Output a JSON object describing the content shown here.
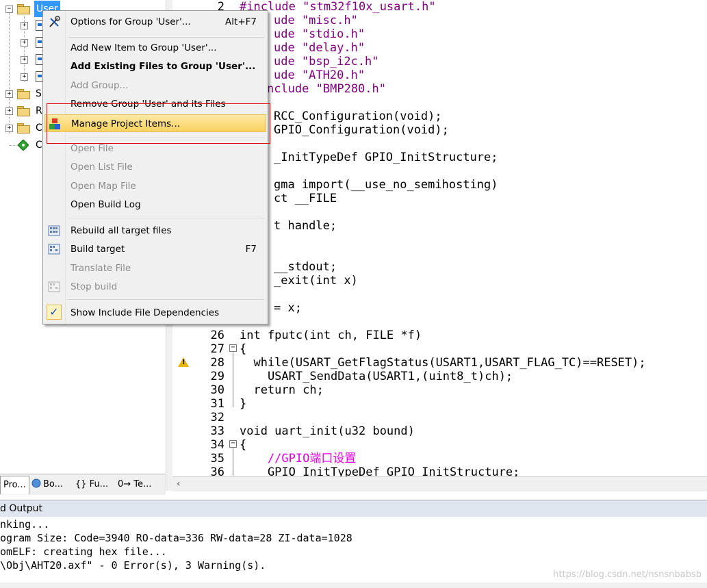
{
  "tree": {
    "root_label": "User",
    "rows": [
      {
        "label": "S"
      },
      {
        "label": "R"
      },
      {
        "label": "C"
      },
      {
        "label": "C"
      }
    ]
  },
  "context_menu": {
    "items": [
      {
        "label": "Options for Group 'User'...",
        "shortcut": "Alt+F7",
        "icon": "options-icon"
      },
      {
        "label": "Add New  Item to Group 'User'..."
      },
      {
        "label": "Add Existing Files to Group 'User'..."
      },
      {
        "label": "Add Group..."
      },
      {
        "label": "Remove Group 'User' and its Files"
      },
      {
        "label": "Manage Project Items...",
        "icon": "manage-project-icon"
      },
      {
        "label": "Open File"
      },
      {
        "label": "Open List File"
      },
      {
        "label": "Open Map File"
      },
      {
        "label": "Open Build Log"
      },
      {
        "label": "Rebuild all target files",
        "icon": "rebuild-icon"
      },
      {
        "label": "Build target",
        "shortcut": "F7",
        "icon": "build-icon"
      },
      {
        "label": "Translate File"
      },
      {
        "label": "Stop build",
        "icon": "stop-build-icon"
      },
      {
        "label": "Show Include File Dependencies",
        "icon": "check-icon"
      }
    ]
  },
  "editor": {
    "lines": [
      {
        "no": "2",
        "code": "#include \"stm32f10x_usart.h\""
      },
      {
        "no": "",
        "code": "ude \"misc.h\""
      },
      {
        "no": "",
        "code": "ude \"stdio.h\""
      },
      {
        "no": "",
        "code": "ude \"delay.h\""
      },
      {
        "no": "",
        "code": "ude \"bsp_i2c.h\""
      },
      {
        "no": "",
        "code": "ude \"ATH20.h\""
      },
      {
        "no": "",
        "code": "nclude \"BMP280.h\""
      },
      {
        "no": "",
        "code": "RCC_Configuration(void);"
      },
      {
        "no": "",
        "code": "GPIO_Configuration(void);"
      },
      {
        "no": "",
        "code": "_InitTypeDef GPIO_InitStructure;"
      },
      {
        "no": "",
        "code": "gma import(__use_no_semihosting)"
      },
      {
        "no": "",
        "code": "ct __FILE"
      },
      {
        "no": "",
        "code": "t handle;"
      },
      {
        "no": "",
        "code": "__stdout;"
      },
      {
        "no": "",
        "code": "_exit(int x)"
      },
      {
        "no": "",
        "code": "= x;"
      },
      {
        "no": "26",
        "code": "int fputc(int ch, FILE *f)"
      },
      {
        "no": "27",
        "code": "{"
      },
      {
        "no": "28",
        "code": "  while(USART_GetFlagStatus(USART1,USART_FLAG_TC)==RESET);"
      },
      {
        "no": "29",
        "code": "    USART_SendData(USART1,(uint8_t)ch);"
      },
      {
        "no": "30",
        "code": "  return ch;"
      },
      {
        "no": "31",
        "code": "}"
      },
      {
        "no": "32",
        "code": ""
      },
      {
        "no": "33",
        "code": "void uart_init(u32 bound)"
      },
      {
        "no": "34",
        "code": "{"
      },
      {
        "no": "35",
        "code": "    //GPIO端口设置"
      },
      {
        "no": "36",
        "code": "    GPIO_InitTypeDef GPIO_InitStructure;"
      }
    ]
  },
  "tabs": [
    {
      "label": "Pro..."
    },
    {
      "label": "Bo..."
    },
    {
      "label": "{} Fu..."
    },
    {
      "label": "0→ Te..."
    }
  ],
  "output": {
    "title": "d Output",
    "lines": [
      "nking...",
      "ogram Size: Code=3940 RO-data=336 RW-data=28 ZI-data=1028",
      "omELF: creating hex file...",
      "\\Obj\\AHT20.axf\" - 0 Error(s), 3 Warning(s)."
    ]
  },
  "watermark": "https://blog.csdn.net/nsnsnbabsb",
  "colors": {
    "menu_highlight": "#f9d25f",
    "selection": "#3399ff",
    "callout_border": "#e00000"
  }
}
